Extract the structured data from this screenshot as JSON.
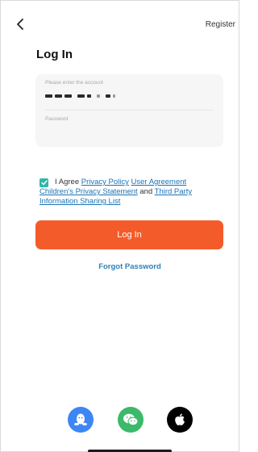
{
  "header": {
    "register_label": "Register"
  },
  "title": "Log In",
  "form": {
    "account_placeholder": "Please enter the account",
    "account_value_masked": "■■■ ■■ ■ ■ ■",
    "password_placeholder": "Password"
  },
  "agreement": {
    "checked": true,
    "prefix": "I Agree",
    "privacy_policy": "Privacy Policy",
    "user_agreement": "User Agreement",
    "children_privacy": "Children's Privacy Statement",
    "and": "and",
    "third_party": "Third Party Information Sharing List"
  },
  "login_button_label": "Log In",
  "forgot_password_label": "Forgot Password",
  "social": [
    {
      "icon": "qq-icon",
      "color": "#3d86f5"
    },
    {
      "icon": "wechat-icon",
      "color": "#3cb96a"
    },
    {
      "icon": "apple-icon",
      "color": "#000000"
    }
  ],
  "colors": {
    "accent": "#f45b2a",
    "link": "#1a73b5",
    "checkbox": "#2fb8a5"
  }
}
